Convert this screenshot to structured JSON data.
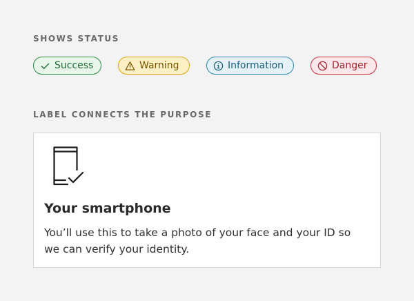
{
  "sections": {
    "status_title": "SHOWS STATUS",
    "purpose_title": "LABEL CONNECTS THE PURPOSE"
  },
  "badges": [
    {
      "label": "Success",
      "icon": "check-icon",
      "color": "#2f8a4a"
    },
    {
      "label": "Warning",
      "icon": "warning-triangle-icon",
      "color": "#d9a512"
    },
    {
      "label": "Information",
      "icon": "info-circle-icon",
      "color": "#2e86ad"
    },
    {
      "label": "Danger",
      "icon": "prohibited-icon",
      "color": "#c3303e"
    }
  ],
  "card": {
    "icon": "smartphone-check-icon",
    "title": "Your smartphone",
    "text": "You’ll use this to take a photo of your face and your ID so we can verify your identity."
  }
}
